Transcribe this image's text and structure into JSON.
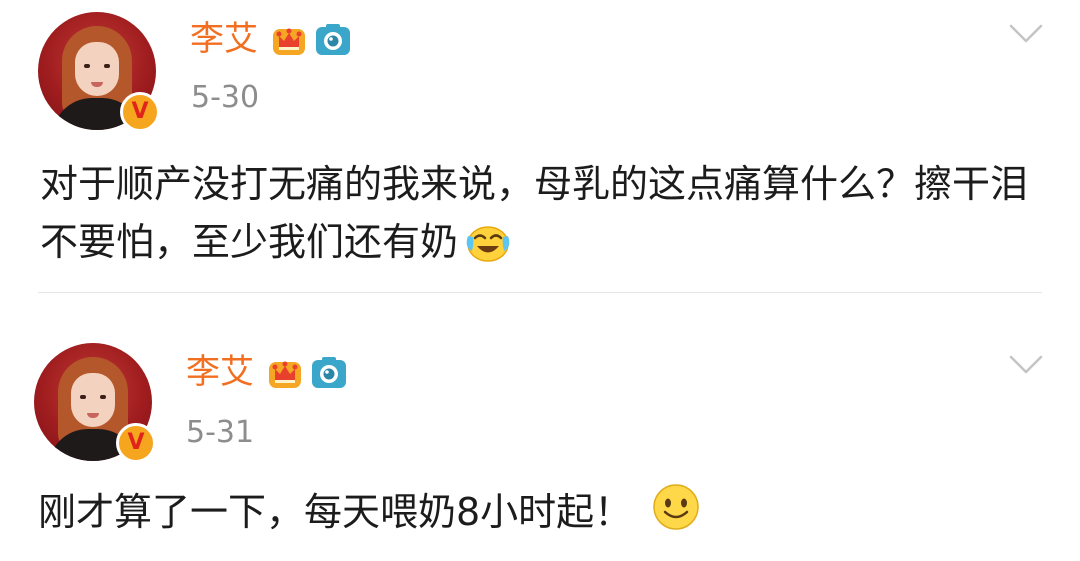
{
  "posts": [
    {
      "username": "李艾",
      "timestamp": "5-30",
      "text": "对于顺产没打无痛的我来说，母乳的这点痛算什么？擦干泪不要怕，至少我们还有奶",
      "emoji": "laugh-cry-emoji",
      "badge": "V"
    },
    {
      "username": "李艾",
      "timestamp": "5-31",
      "text": "刚才算了一下，每天喂奶8小时起！ ",
      "emoji": "smile-emoji",
      "badge": "V"
    }
  ],
  "colors": {
    "username": "#f26f21",
    "timestamp": "#8d8d8d",
    "badge": "#f6a51f",
    "divider": "#e6e6e6"
  },
  "icons": [
    "crown-icon",
    "camera-icon",
    "chevron-down-icon",
    "verified-badge-icon"
  ]
}
